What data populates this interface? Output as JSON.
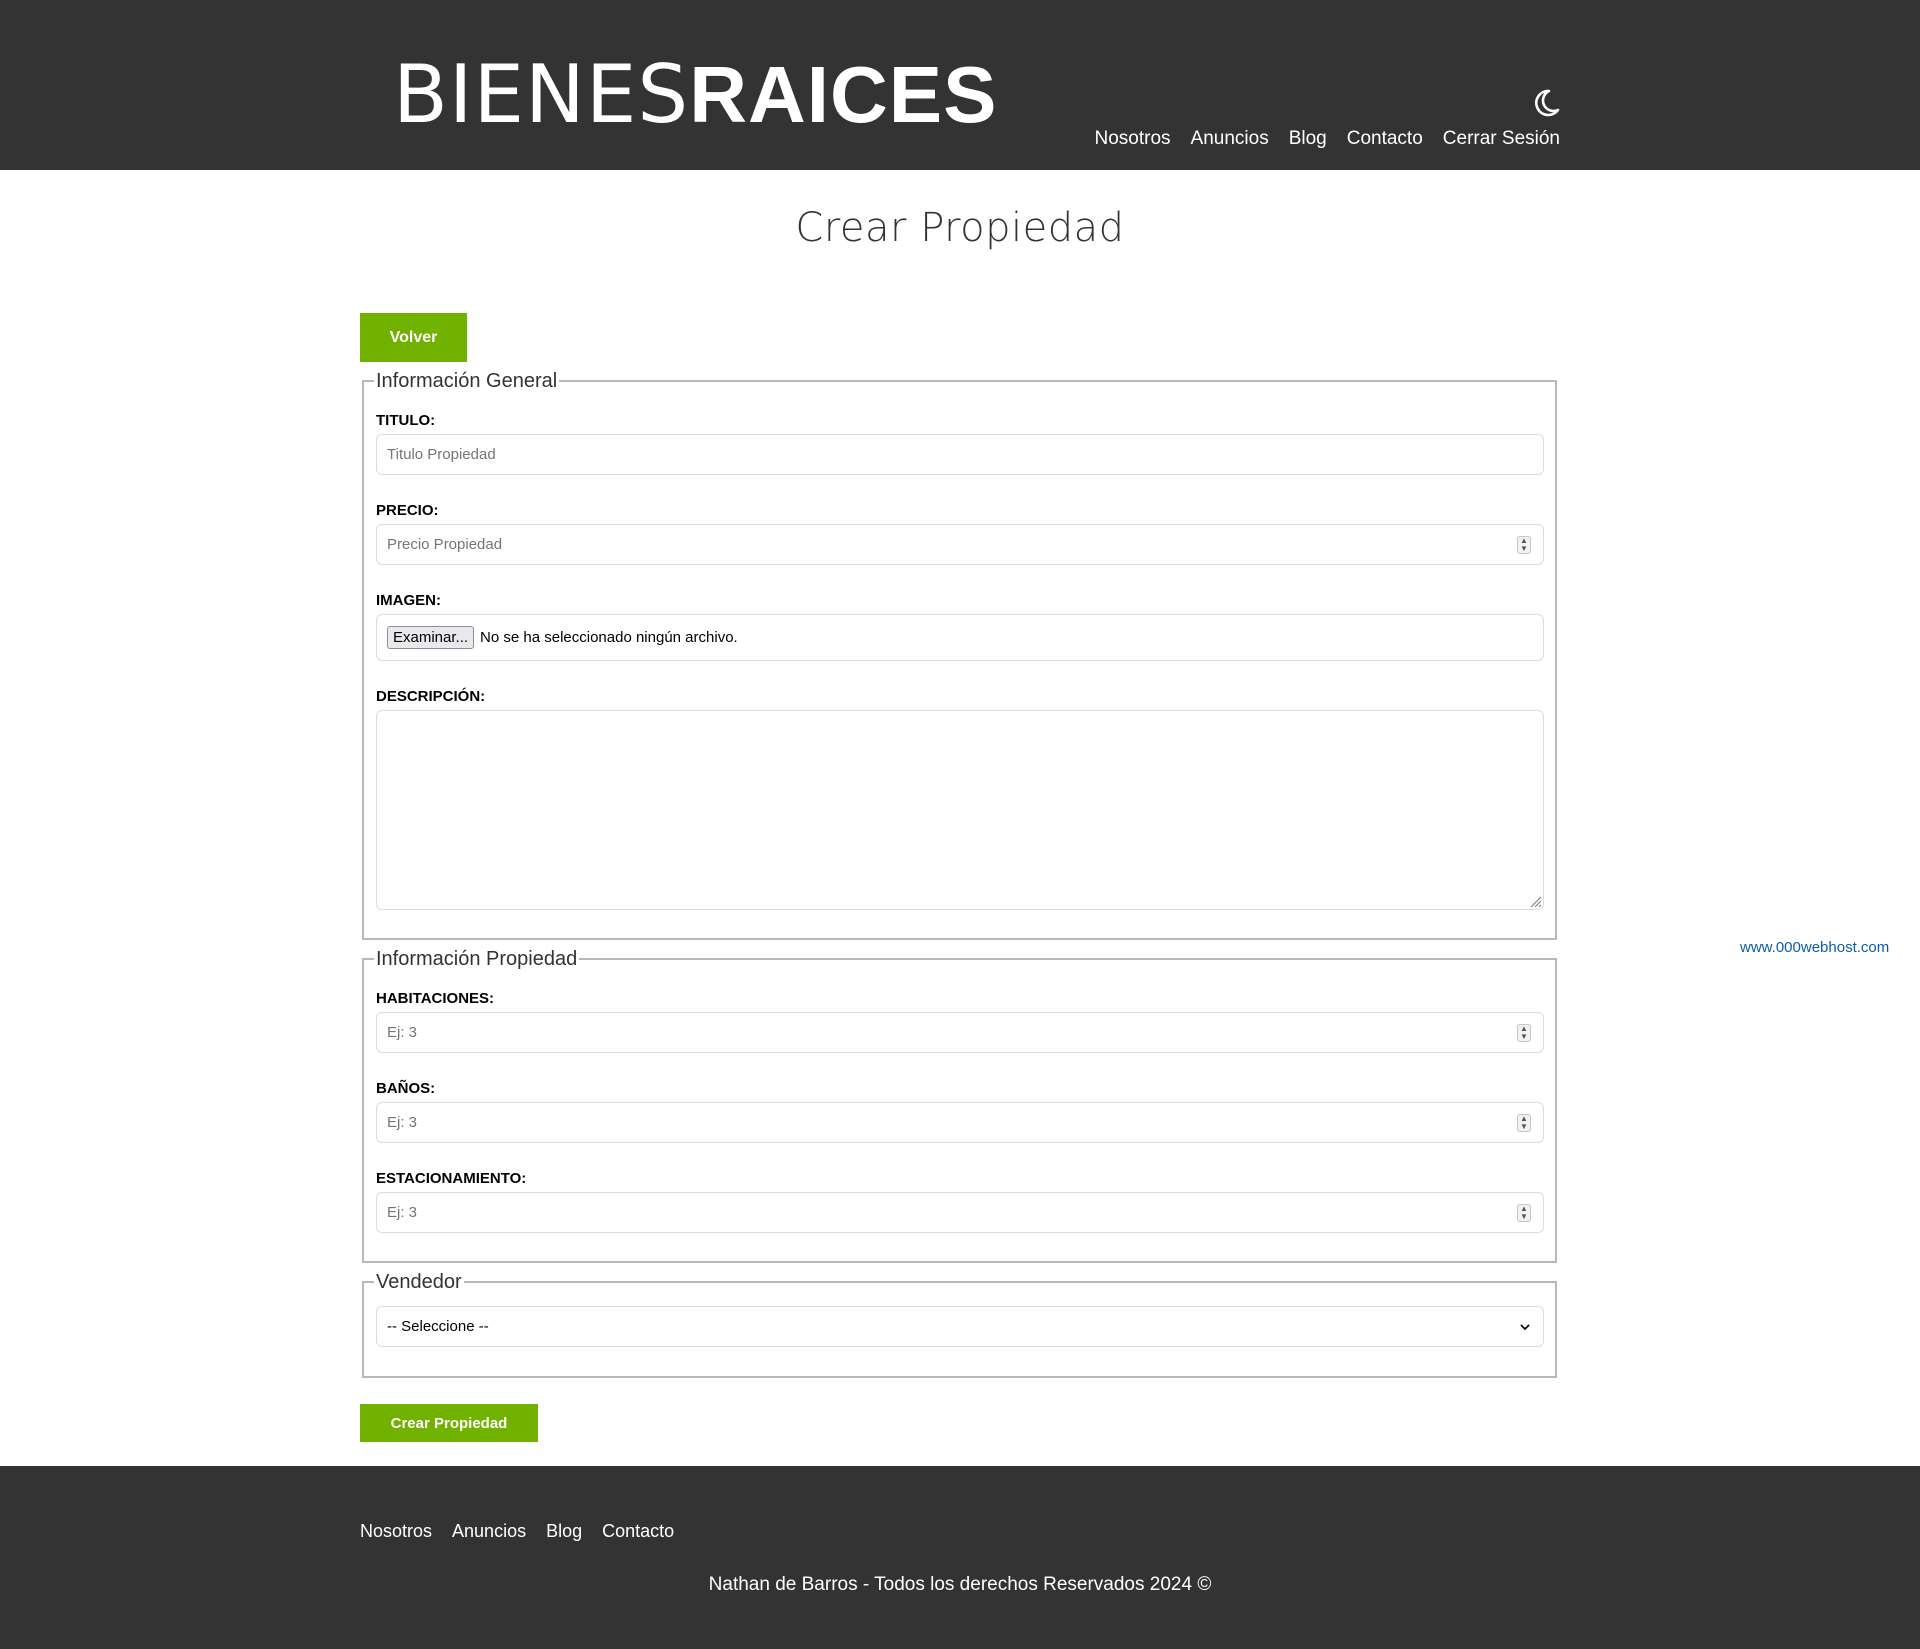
{
  "header": {
    "logo_light": "BIENES",
    "logo_bold": "RAICES",
    "nav": [
      "Nosotros",
      "Anuncios",
      "Blog",
      "Contacto",
      "Cerrar Sesión"
    ]
  },
  "page_title": "Crear Propiedad",
  "back_button": "Volver",
  "general": {
    "legend": "Información General",
    "titulo_label": "TITULO:",
    "titulo_placeholder": "Titulo Propiedad",
    "precio_label": "PRECIO:",
    "precio_placeholder": "Precio Propiedad",
    "imagen_label": "IMAGEN:",
    "file_button": "Examinar...",
    "file_status": "No se ha seleccionado ningún archivo.",
    "descripcion_label": "DESCRIPCIÓN:"
  },
  "propiedad": {
    "legend": "Información Propiedad",
    "habitaciones_label": "HABITACIONES:",
    "habitaciones_placeholder": "Ej: 3",
    "banos_label": "BAÑOS:",
    "banos_placeholder": "Ej: 3",
    "estacionamiento_label": "ESTACIONAMIENTO:",
    "estacionamiento_placeholder": "Ej: 3"
  },
  "vendedor": {
    "legend": "Vendedor",
    "selected": "-- Seleccione --"
  },
  "submit_button": "Crear Propiedad",
  "host_link": "www.000webhost.com",
  "footer": {
    "nav": [
      "Nosotros",
      "Anuncios",
      "Blog",
      "Contacto"
    ],
    "copyright": "Nathan de Barros - Todos los derechos Reservados 2024 ©"
  },
  "colors": {
    "header_bg": "#333333",
    "accent_green": "#71b100",
    "link_blue": "#0b5cad"
  }
}
